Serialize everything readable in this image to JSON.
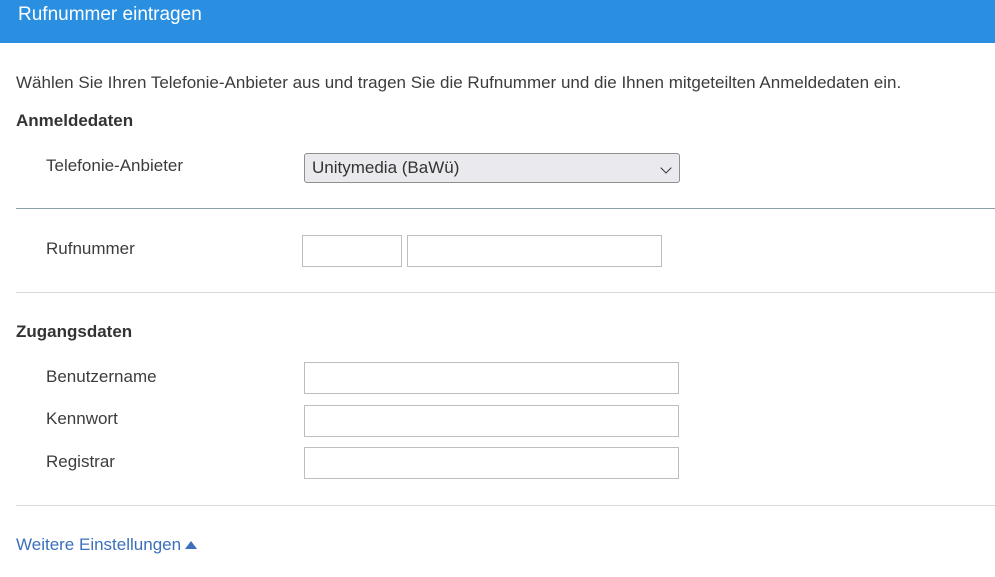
{
  "header": {
    "title": "Rufnummer eintragen"
  },
  "intro": "Wählen Sie Ihren Telefonie-Anbieter aus und tragen Sie die Rufnummer und die Ihnen mitgeteilten Anmeldedaten ein.",
  "anmeldedaten": {
    "title": "Anmeldedaten",
    "provider_label": "Telefonie-Anbieter",
    "provider_value": "Unitymedia (BaWü)"
  },
  "rufnummer": {
    "label": "Rufnummer",
    "prefix_value": "",
    "number_value": ""
  },
  "zugangsdaten": {
    "title": "Zugangsdaten",
    "username_label": "Benutzername",
    "username_value": "",
    "password_label": "Kennwort",
    "password_value": "",
    "registrar_label": "Registrar",
    "registrar_value": ""
  },
  "more_settings": {
    "label": "Weitere Einstellungen",
    "icon": "triangle-up-icon"
  },
  "colors": {
    "header_bg": "#2a8fe0",
    "link": "#3b6fbc"
  }
}
